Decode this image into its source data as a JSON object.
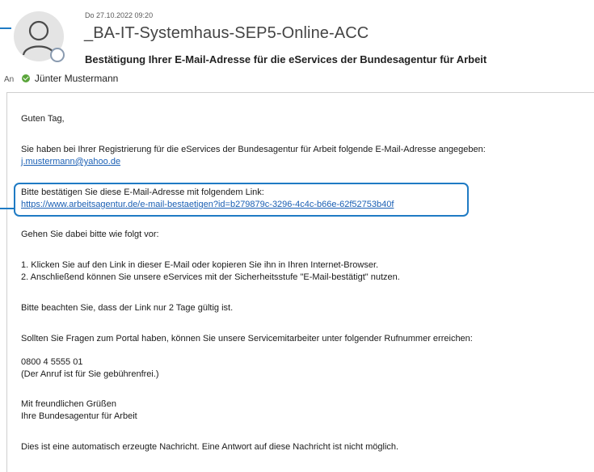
{
  "email": {
    "date": "Do 27.10.2022 09:20",
    "sender": "_BA-IT-Systemhaus-SEP5-Online-ACC",
    "subject": "Bestätigung Ihrer E-Mail-Adresse für die eServices der Bundesagentur für Arbeit",
    "to_label": "An",
    "recipient": "Jünter Mustermann"
  },
  "body": {
    "greeting": "Guten Tag,",
    "intro": "Sie haben bei Ihrer Registrierung für die eServices der Bundesagentur für Arbeit folgende E-Mail-Adresse angegeben:",
    "email_address": "j.mustermann@yahoo.de",
    "confirm_text": "Bitte bestätigen Sie diese E-Mail-Adresse mit folgendem Link:",
    "confirm_link": "https://www.arbeitsagentur.de/e-mail-bestaetigen?id=b279879c-3296-4c4c-b66e-62f52753b40f",
    "proceed": "Gehen Sie dabei bitte wie folgt vor:",
    "step1": "1. Klicken Sie auf den Link in dieser E-Mail oder kopieren Sie ihn in Ihren Internet-Browser.",
    "step2": "2. Anschließend können Sie unsere eServices mit der Sicherheitsstufe \"E-Mail-bestätigt\" nutzen.",
    "validity": "Bitte beachten Sie, dass der Link nur 2 Tage gültig ist.",
    "questions": "Sollten Sie Fragen zum Portal haben, können Sie unsere Servicemitarbeiter unter folgender Rufnummer erreichen:",
    "phone": "0800 4 5555 01",
    "phone_note": "(Der Anruf ist für Sie gebührenfrei.)",
    "closing": "Mit freundlichen Grüßen",
    "signature": "Ihre Bundesagentur für Arbeit",
    "auto_notice": "Dies ist eine automatisch erzeugte Nachricht. Eine Antwort auf diese Nachricht ist nicht möglich."
  },
  "colors": {
    "accent": "#1f7bc4",
    "link": "#1a5fb4",
    "presence_ok": "#5aa53a"
  }
}
